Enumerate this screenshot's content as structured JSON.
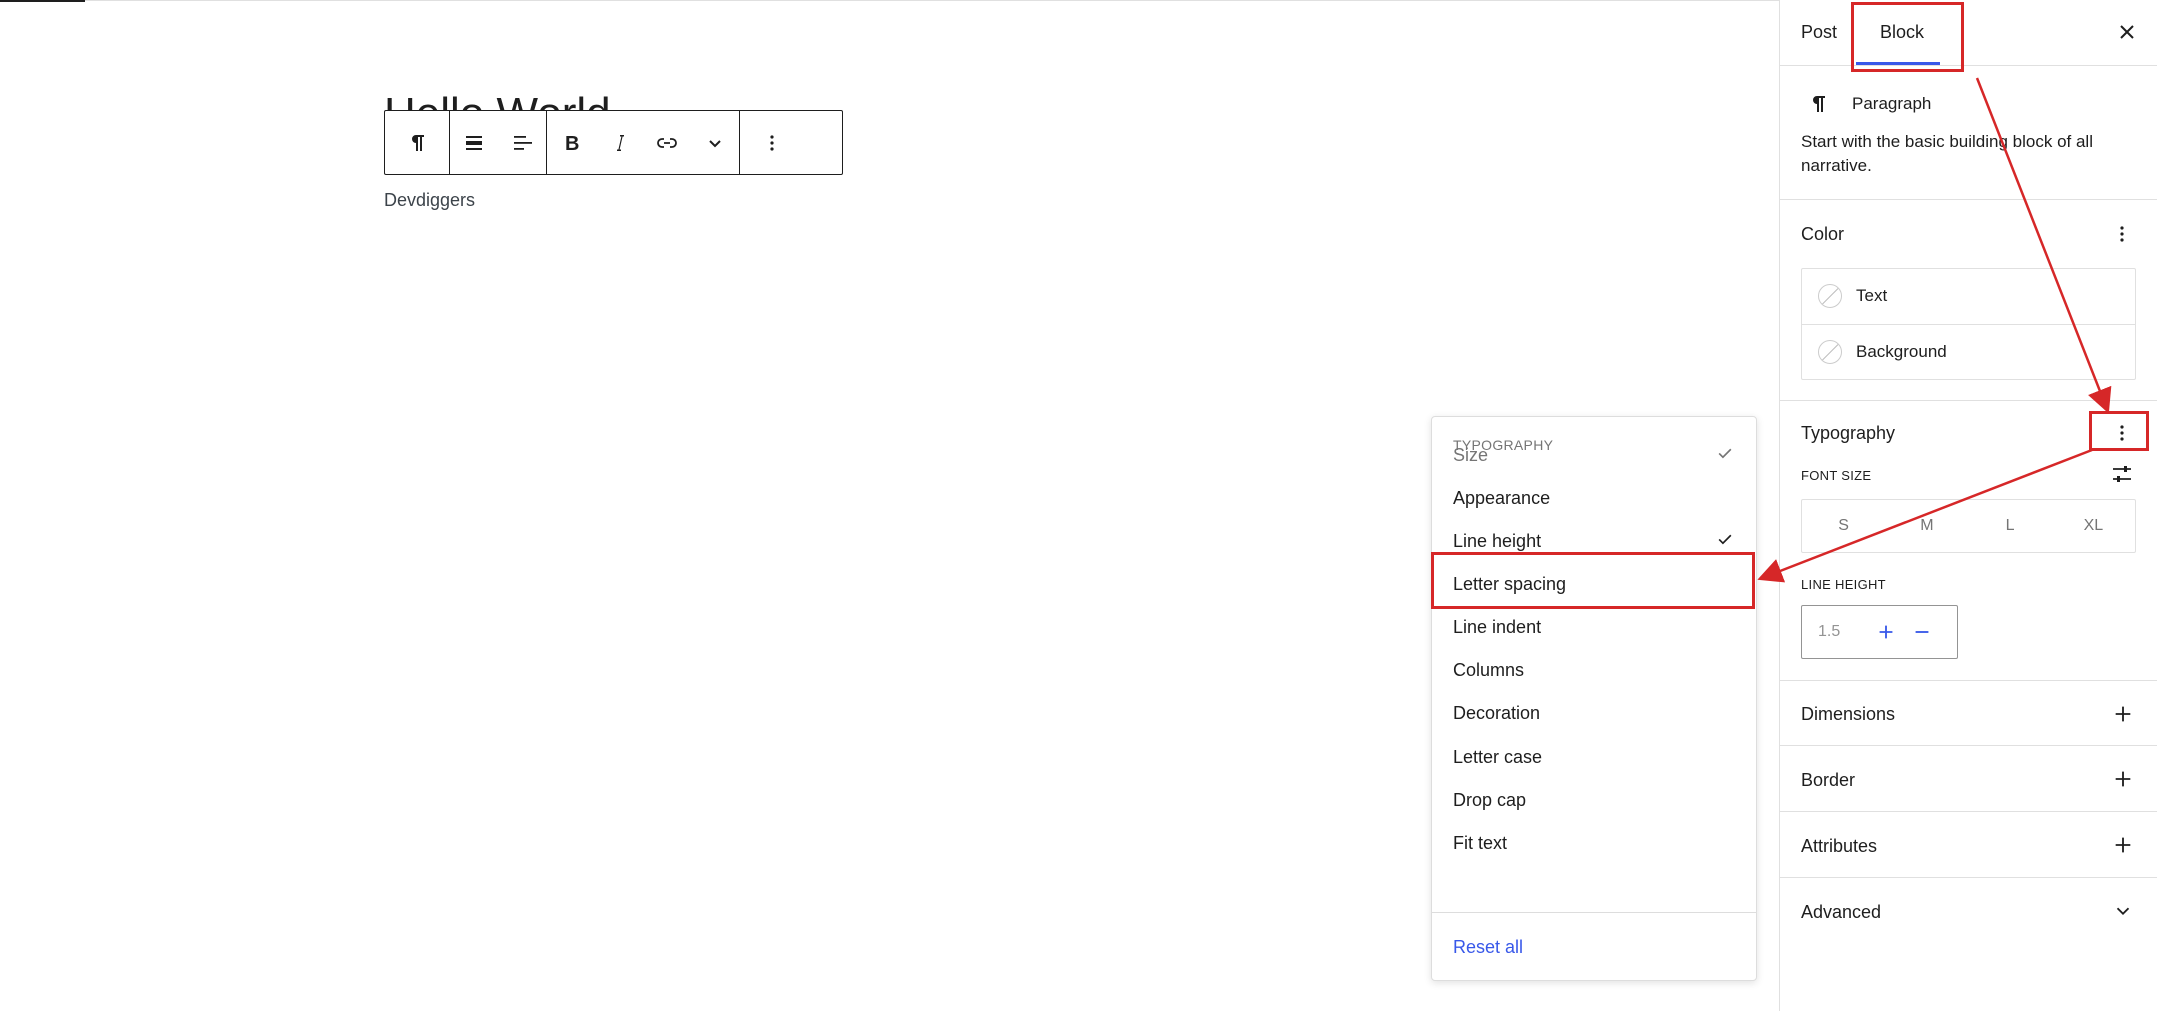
{
  "editor": {
    "title_partial": "Hello World",
    "paragraph_text": "Devdiggers"
  },
  "toolbar": {
    "buttons": [
      "paragraph-icon",
      "align-wide-icon",
      "align-left-icon",
      "bold-icon",
      "italic-icon",
      "link-icon",
      "chevron-down-icon",
      "more-vertical-icon"
    ]
  },
  "typography_menu": {
    "heading": "TYPOGRAPHY",
    "items": [
      {
        "label": "Size",
        "checked": true
      },
      {
        "label": "Appearance",
        "checked": false
      },
      {
        "label": "Line height",
        "checked": true
      },
      {
        "label": "Letter spacing",
        "checked": false
      },
      {
        "label": "Line indent",
        "checked": false
      },
      {
        "label": "Columns",
        "checked": false
      },
      {
        "label": "Decoration",
        "checked": false
      },
      {
        "label": "Letter case",
        "checked": false
      },
      {
        "label": "Drop cap",
        "checked": false
      },
      {
        "label": "Fit text",
        "checked": false
      }
    ],
    "reset_label": "Reset all"
  },
  "sidebar": {
    "tabs": {
      "post": "Post",
      "block": "Block"
    },
    "block_card": {
      "title": "Paragraph",
      "description": "Start with the basic building block of all narrative."
    },
    "color": {
      "title": "Color",
      "text_label": "Text",
      "background_label": "Background"
    },
    "typography": {
      "title": "Typography",
      "font_size_label": "FONT SIZE",
      "font_sizes": [
        "S",
        "M",
        "L",
        "XL"
      ],
      "line_height_label": "LINE HEIGHT",
      "line_height_value": "1.5"
    },
    "panels": {
      "dimensions": "Dimensions",
      "border": "Border",
      "attributes": "Attributes",
      "advanced": "Advanced"
    }
  },
  "colors": {
    "accent": "#3858e9",
    "annotation": "#d62728",
    "text": "#1e1e1e"
  }
}
